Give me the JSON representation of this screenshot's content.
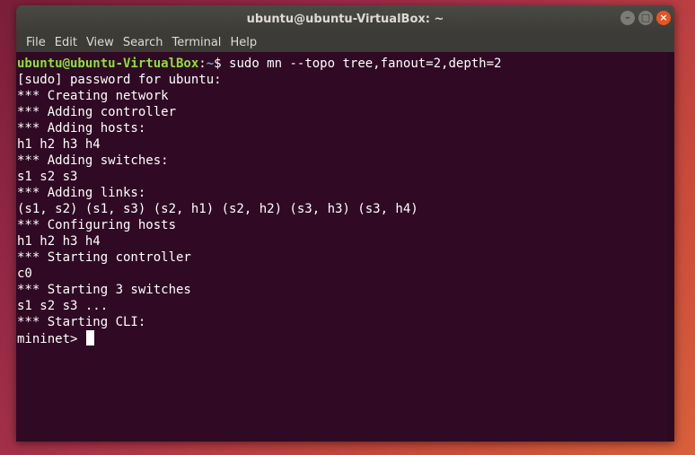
{
  "window": {
    "title": "ubuntu@ubuntu-VirtualBox: ~",
    "buttons": {
      "minimize": "–",
      "maximize": "□",
      "close": "×"
    }
  },
  "menu": [
    "File",
    "Edit",
    "View",
    "Search",
    "Terminal",
    "Help"
  ],
  "terminal": {
    "prompt_user": "ubuntu@ubuntu-VirtualBox",
    "prompt_sep": ":",
    "prompt_path": "~",
    "prompt_symbol": "$ ",
    "command": "sudo mn --topo tree,fanout=2,depth=2",
    "output": [
      "[sudo] password for ubuntu:",
      "*** Creating network",
      "*** Adding controller",
      "*** Adding hosts:",
      "h1 h2 h3 h4",
      "*** Adding switches:",
      "s1 s2 s3",
      "*** Adding links:",
      "(s1, s2) (s1, s3) (s2, h1) (s2, h2) (s3, h3) (s3, h4)",
      "*** Configuring hosts",
      "h1 h2 h3 h4",
      "*** Starting controller",
      "c0",
      "*** Starting 3 switches",
      "s1 s2 s3 ...",
      "*** Starting CLI:"
    ],
    "cli_prompt": "mininet> "
  },
  "colors": {
    "background": "#300a24",
    "user": "#8ae234",
    "path": "#729fcf",
    "accent": "#e95420"
  }
}
